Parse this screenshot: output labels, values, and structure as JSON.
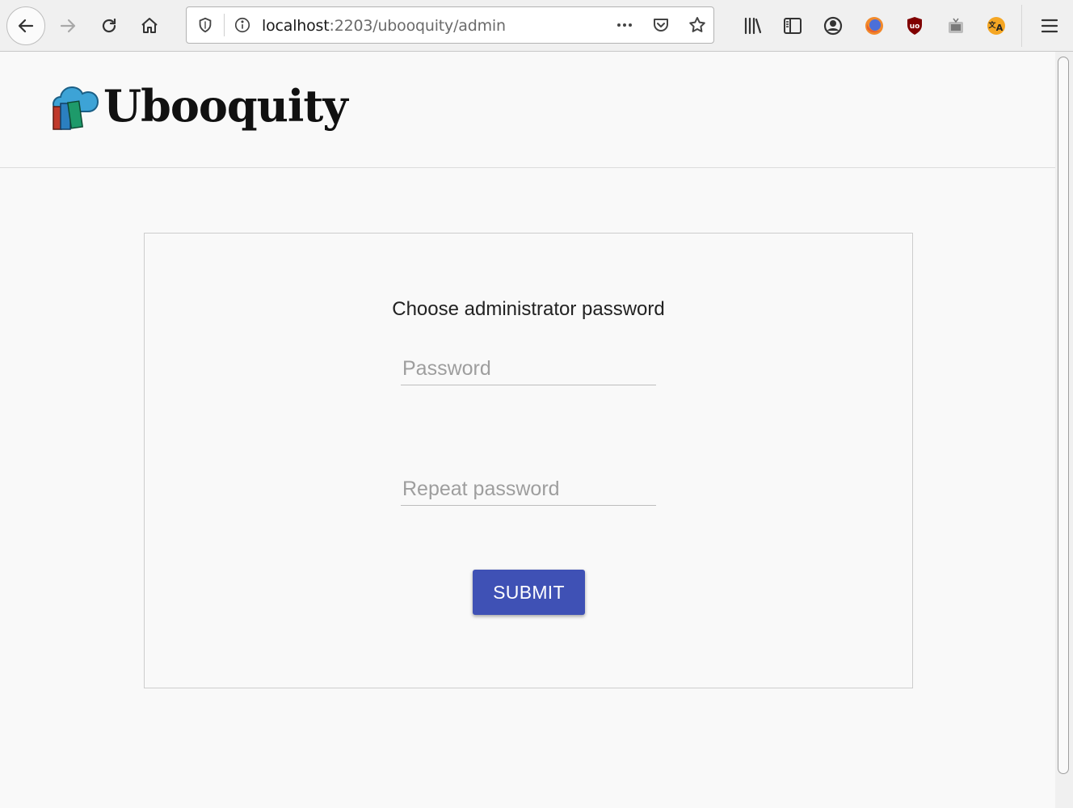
{
  "browser": {
    "url_host": "localhost",
    "url_rest": ":2203/ubooquity/admin",
    "icons": [
      "back-icon",
      "forward-icon",
      "reload-icon",
      "home-icon",
      "shield-icon",
      "info-icon",
      "more-icon",
      "pocket-icon",
      "star-icon",
      "library-icon",
      "sidebar-icon",
      "account-icon",
      "firefox-icon",
      "ublock-icon",
      "extension-icon",
      "translate-icon",
      "menu-icon"
    ]
  },
  "app": {
    "name": "Ubooquity"
  },
  "form": {
    "title": "Choose administrator password",
    "password_placeholder": "Password",
    "repeat_placeholder": "Repeat password",
    "submit_label": "SUBMIT"
  },
  "colors": {
    "accent": "#3f51b5",
    "background": "#f9f9f9"
  }
}
